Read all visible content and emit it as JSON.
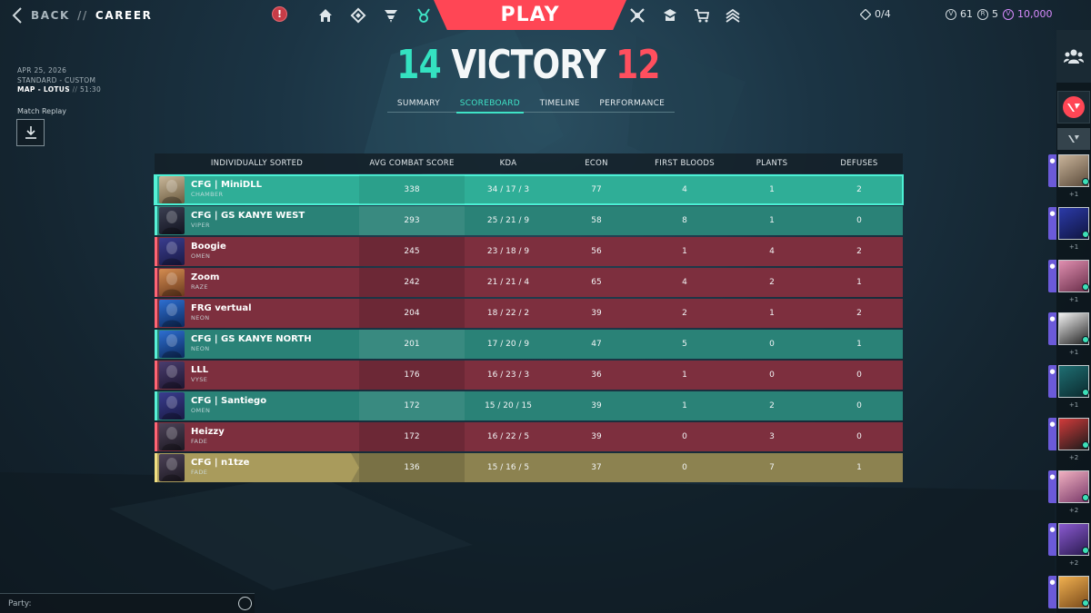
{
  "topbar": {
    "back_label": "BACK",
    "separator": "//",
    "page_label": "CAREER",
    "alert_glyph": "!",
    "play_label": "PLAY",
    "nav_left_icons": [
      "home-icon",
      "collection-icon",
      "agents-icon",
      "career-icon"
    ],
    "nav_right_icons": [
      "battlepass-icon",
      "premier-icon",
      "store-icon",
      "rank-icon"
    ],
    "missions_count": "0/4",
    "currency": {
      "kingdom_credits": "61",
      "radianite": "5",
      "valorant_points": "10,000"
    }
  },
  "match": {
    "date": "APR 25, 2026",
    "mode": "STANDARD - CUSTOM",
    "map": "MAP - LOTUS",
    "separator": "//",
    "duration": "51:30",
    "replay_label": "Match Replay"
  },
  "score": {
    "team_score": "14",
    "result": "VICTORY",
    "enemy_score": "12"
  },
  "tabs": [
    {
      "label": "SUMMARY",
      "active": false
    },
    {
      "label": "SCOREBOARD",
      "active": true
    },
    {
      "label": "TIMELINE",
      "active": false
    },
    {
      "label": "PERFORMANCE",
      "active": false
    }
  ],
  "scoreboard": {
    "headers": [
      "INDIVIDUALLY SORTED",
      "AVG COMBAT SCORE",
      "KDA",
      "ECON",
      "FIRST BLOODS",
      "PLANTS",
      "DEFUSES"
    ],
    "rows": [
      {
        "name": "CFG | MiniDLL",
        "agent": "CHAMBER",
        "team": "green",
        "self": true,
        "acs": "338",
        "kda": "34 / 17 / 3",
        "econ": "77",
        "fb": "4",
        "plants": "1",
        "defuses": "2"
      },
      {
        "name": "CFG | GS KANYE WEST",
        "agent": "VIPER",
        "team": "green",
        "self": false,
        "acs": "293",
        "kda": "25 / 21 / 9",
        "econ": "58",
        "fb": "8",
        "plants": "1",
        "defuses": "0"
      },
      {
        "name": "Boogie",
        "agent": "OMEN",
        "team": "red",
        "self": false,
        "acs": "245",
        "kda": "23 / 18 / 9",
        "econ": "56",
        "fb": "1",
        "plants": "4",
        "defuses": "2"
      },
      {
        "name": "Zoom",
        "agent": "RAZE",
        "team": "red",
        "self": false,
        "acs": "242",
        "kda": "21 / 21 / 4",
        "econ": "65",
        "fb": "4",
        "plants": "2",
        "defuses": "1"
      },
      {
        "name": "FRG vertual",
        "agent": "NEON",
        "team": "red",
        "self": false,
        "acs": "204",
        "kda": "18 / 22 / 2",
        "econ": "39",
        "fb": "2",
        "plants": "1",
        "defuses": "2"
      },
      {
        "name": "CFG | GS KANYE NORTH",
        "agent": "NEON",
        "team": "green",
        "self": false,
        "acs": "201",
        "kda": "17 / 20 / 9",
        "econ": "47",
        "fb": "5",
        "plants": "0",
        "defuses": "1"
      },
      {
        "name": "LLL",
        "agent": "VYSE",
        "team": "red",
        "self": false,
        "acs": "176",
        "kda": "16 / 23 / 3",
        "econ": "36",
        "fb": "1",
        "plants": "0",
        "defuses": "0"
      },
      {
        "name": "CFG | Santiego",
        "agent": "OMEN",
        "team": "green",
        "self": false,
        "acs": "172",
        "kda": "15 / 20 / 15",
        "econ": "39",
        "fb": "1",
        "plants": "2",
        "defuses": "0"
      },
      {
        "name": "Heizzy",
        "agent": "FADE",
        "team": "red",
        "self": false,
        "acs": "172",
        "kda": "16 / 22 / 5",
        "econ": "39",
        "fb": "0",
        "plants": "3",
        "defuses": "0"
      },
      {
        "name": "CFG | n1tze",
        "agent": "FADE",
        "team": "gold",
        "self": false,
        "acs": "136",
        "kda": "15 / 16 / 5",
        "econ": "37",
        "fb": "0",
        "plants": "7",
        "defuses": "1"
      }
    ]
  },
  "party": {
    "label": "Party:"
  },
  "social": {
    "friends": [
      {
        "count": "+1",
        "avatar": "cowboy-hat-avatar"
      },
      {
        "count": "+1",
        "avatar": "blue-face-avatar"
      },
      {
        "count": "+1",
        "avatar": "anime-character-avatar"
      },
      {
        "count": "+1",
        "avatar": "white-creature-avatar"
      },
      {
        "count": "+1",
        "avatar": "teal-dragon-avatar"
      },
      {
        "count": "+2",
        "avatar": "fn-logo-avatar"
      },
      {
        "count": "+2",
        "avatar": "anime-pink-avatar"
      },
      {
        "count": "+2",
        "avatar": "purple-character-avatar"
      },
      {
        "count": "",
        "avatar": "orange-character-avatar"
      }
    ]
  },
  "colors": {
    "accent_red": "#ff4655",
    "team_green": "#2a8277",
    "team_red": "#7d2f3e",
    "self_green": "#2fae97",
    "gold_row": "#8c8250",
    "victory_cyan": "#34e2c1"
  }
}
